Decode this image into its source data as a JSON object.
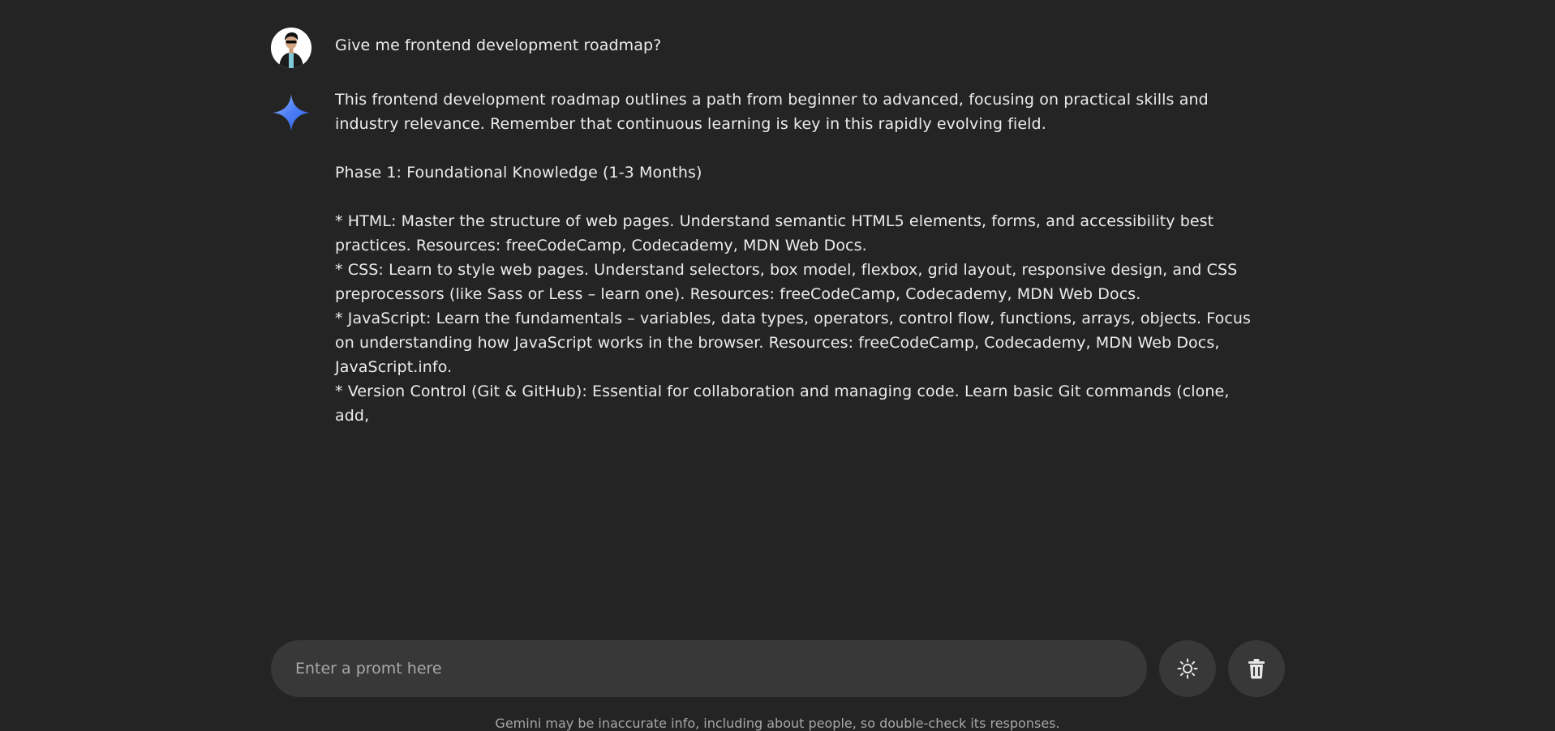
{
  "conversation": {
    "user_message": "Give me frontend development roadmap?",
    "bot_response": "This frontend development roadmap outlines a path from beginner to advanced, focusing on practical skills and\nindustry relevance. Remember that continuous learning is key in this rapidly evolving field.\n\nPhase 1: Foundational Knowledge (1-3 Months)\n\n* HTML: Master the structure of web pages. Understand semantic HTML5 elements, forms, and accessibility best\npractices. Resources: freeCodeCamp, Codecademy, MDN Web Docs.\n* CSS: Learn to style web pages. Understand selectors, box model, flexbox, grid layout, responsive design, and CSS\npreprocessors (like Sass or Less – learn one). Resources: freeCodeCamp, Codecademy, MDN Web Docs.\n* JavaScript: Learn the fundamentals – variables, data types, operators, control flow, functions, arrays, objects. Focus\non understanding how JavaScript works in the browser. Resources: freeCodeCamp, Codecademy, MDN Web Docs,\nJavaScript.info.\n* Version Control (Git & GitHub): Essential for collaboration and managing code. Learn basic Git commands (clone,\nadd,"
  },
  "input": {
    "placeholder": "Enter a promt here",
    "value": ""
  },
  "buttons": {
    "theme_icon": "sun-icon",
    "delete_icon": "trash-icon"
  },
  "footer": {
    "disclaimer": "Gemini may be inaccurate info, including about people, so double-check its responses."
  },
  "colors": {
    "background": "#242424",
    "surface": "#383838",
    "gemini_blue": "#4285f4",
    "text": "#ececec"
  }
}
